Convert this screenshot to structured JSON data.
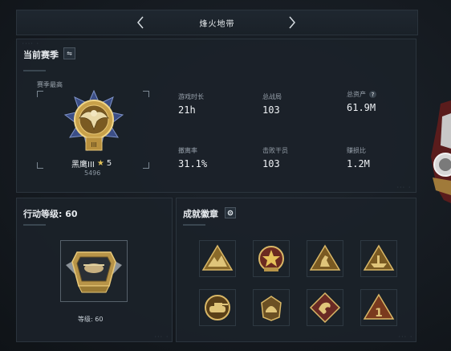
{
  "header": {
    "title": "烽火地带"
  },
  "season": {
    "title": "当前赛季",
    "best_label": "赛季最高",
    "rank_name": "黑鹰III",
    "star_count": "5",
    "rank_score": "5496",
    "stats": [
      {
        "label": "游戏时长",
        "value": "21h"
      },
      {
        "label": "总战局",
        "value": "103"
      },
      {
        "label": "总资产",
        "value": "61.9M",
        "help": "?"
      },
      {
        "label": "撤离率",
        "value": "31.1%"
      },
      {
        "label": "击败干员",
        "value": "103"
      },
      {
        "label": "赚损比",
        "value": "1.2M"
      }
    ]
  },
  "level": {
    "title": "行动等级: 60",
    "caption": "等级: 60"
  },
  "badges": {
    "title": "成就徽章",
    "items": [
      "terrain-triangle-badge",
      "star-shield-badge",
      "kangaroo-triangle-badge",
      "ship-triangle-badge",
      "tank-badge",
      "helmet-badge",
      "dragon-diamond-badge",
      "number-one-triangle-badge"
    ]
  },
  "colors": {
    "background": "#151a20",
    "panel": "#1b2229",
    "gold": "#c8a14a",
    "border": "#2b343d"
  }
}
